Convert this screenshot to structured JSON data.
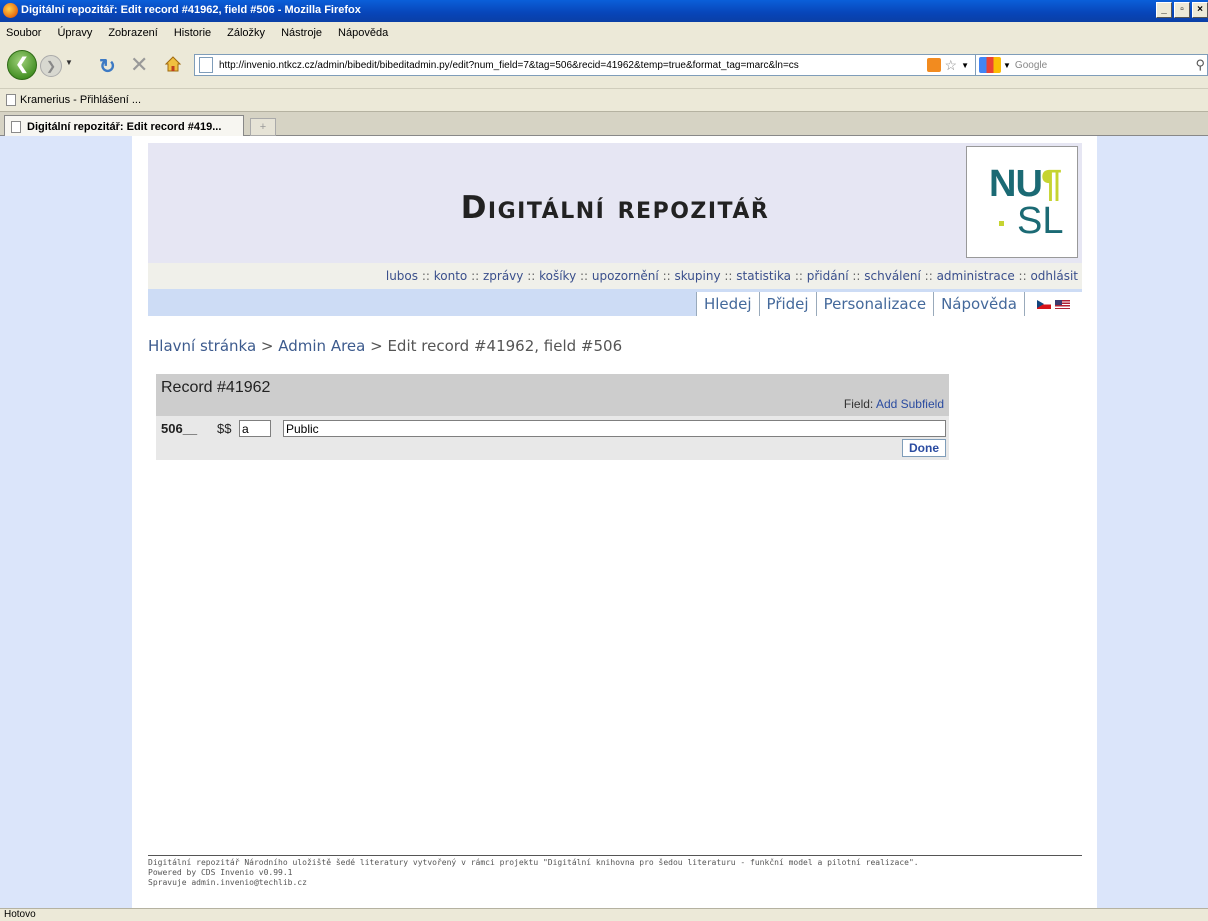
{
  "window": {
    "title": "Digitální repozitář: Edit record #41962, field #506 - Mozilla Firefox",
    "controls": [
      "_",
      "▫",
      "×"
    ]
  },
  "menu": [
    "Soubor",
    "Úpravy",
    "Zobrazení",
    "Historie",
    "Záložky",
    "Nástroje",
    "Nápověda"
  ],
  "toolbar": {
    "url": "http://invenio.ntkcz.cz/admin/bibedit/bibeditadmin.py/edit?num_field=7&tag=506&recid=41962&temp=true&format_tag=marc&ln=cs",
    "search_placeholder": "Google"
  },
  "bookmarks": [
    {
      "label": "Kramerius - Přihlášení ..."
    }
  ],
  "tabs": [
    {
      "label": "Digitální repozitář: Edit record #419..."
    }
  ],
  "site": {
    "title": "Digitální repozitář",
    "logo_top": "NU",
    "logo_bottom": "SL",
    "user_links": [
      "lubos",
      "konto",
      "zprávy",
      "košíky",
      "upozornění",
      "skupiny",
      "statistika",
      "přidání",
      "schválení",
      "administrace",
      "odhlásit"
    ],
    "nav_tabs": [
      "Hledej",
      "Přidej",
      "Personalizace",
      "Nápověda"
    ]
  },
  "breadcrumb": {
    "home": "Hlavní stránka",
    "sep1": " > ",
    "admin": "Admin Area",
    "sep2": " > ",
    "current": "Edit record #41962, field #506"
  },
  "record": {
    "title": "Record #41962",
    "field_label": "Field:",
    "add_subfield": "Add Subfield",
    "tag": "506__",
    "dollars": "$$",
    "subfield_code": "a",
    "subfield_value": "Public",
    "done": "Done"
  },
  "footer": {
    "line1": "Digitální repozitář Národního uložiště šedé literatury vytvořený v rámci projektu \"Digitální knihovna pro šedou literaturu - funkční model a pilotní realizace\".",
    "line2": "Powered by CDS Invenio v0.99.1",
    "line3": "Spravuje admin.invenio@techlib.cz"
  },
  "status": "Hotovo",
  "colors": {
    "accent": "#3d5b8e",
    "page_background": "#dbe5fa",
    "logo_teal": "#1b6a74",
    "logo_green": "#c6d431"
  }
}
